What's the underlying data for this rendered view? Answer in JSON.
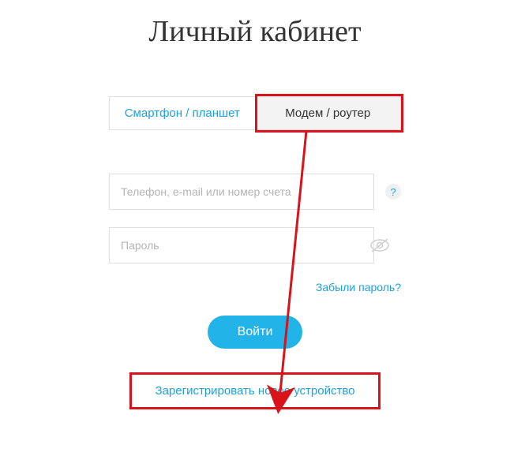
{
  "title": "Личный кабинет",
  "tabs": {
    "left": "Смартфон / планшет",
    "right": "Модем / роутер"
  },
  "fields": {
    "login_placeholder": "Телефон, e-mail или номер счета",
    "password_placeholder": "Пароль",
    "help_symbol": "?"
  },
  "links": {
    "forgot": "Забыли пароль?",
    "register": "Зарегистрировать новое устройство"
  },
  "buttons": {
    "login": "Войти"
  },
  "colors": {
    "accent": "#1ea0dc",
    "btn": "#22b3e8",
    "highlight": "#d8141a"
  }
}
